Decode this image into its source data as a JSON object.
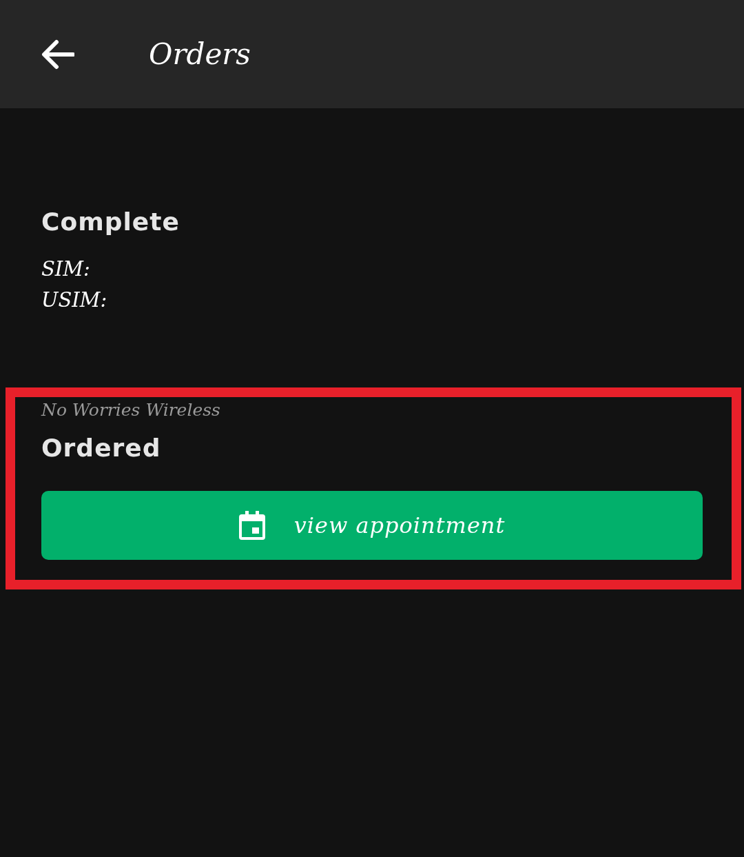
{
  "header": {
    "title": "Orders"
  },
  "orders": [
    {
      "status": "Complete",
      "lines": [
        "SIM:",
        "USIM:"
      ],
      "highlighted": false
    },
    {
      "provider": "No Worries Wireless",
      "status": "Ordered",
      "button": "view appointment",
      "highlighted": true
    }
  ]
}
